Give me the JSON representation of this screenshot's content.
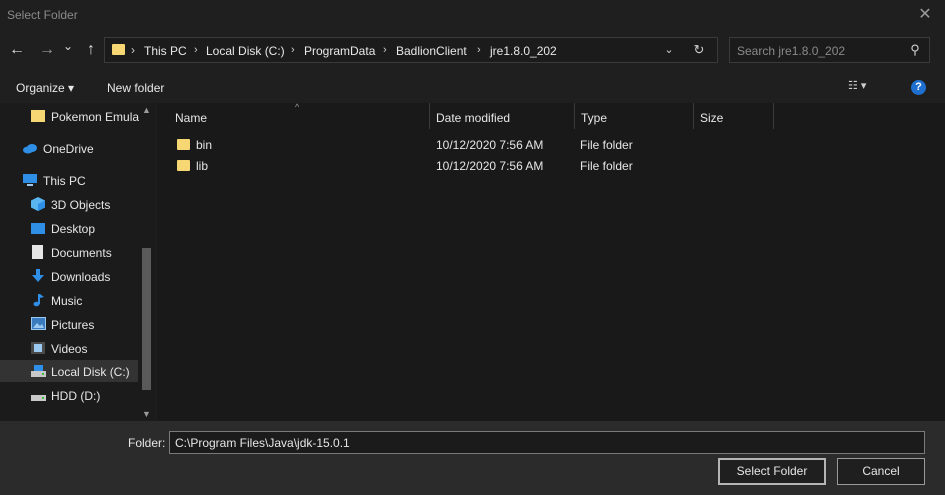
{
  "window": {
    "title": "Select Folder",
    "close_glyph": "✕"
  },
  "nav": {
    "back_glyph": "←",
    "forward_glyph": "→",
    "recent_glyph": "⌄",
    "up_glyph": "↑",
    "breadcrumb_sep": "›",
    "breadcrumbs": [
      "This PC",
      "Local Disk (C:)",
      "ProgramData",
      "BadlionClient",
      "jre1.8.0_202"
    ],
    "dropdown_glyph": "⌄",
    "refresh_glyph": "↻"
  },
  "search": {
    "placeholder": "Search jre1.8.0_202",
    "icon_glyph": "⚲"
  },
  "toolbar": {
    "organize_label": "Organize ▾",
    "new_folder_label": "New folder",
    "view_glyph": "☷ ▾",
    "help_glyph": "?"
  },
  "sidebar": {
    "items": [
      {
        "label": "Pokemon Emula",
        "icon": "folder-icon"
      },
      {
        "label": "OneDrive",
        "icon": "cloud-icon"
      },
      {
        "label": "This PC",
        "icon": "computer-icon"
      },
      {
        "label": "3D Objects",
        "icon": "cube-icon"
      },
      {
        "label": "Desktop",
        "icon": "desktop-icon"
      },
      {
        "label": "Documents",
        "icon": "document-icon"
      },
      {
        "label": "Downloads",
        "icon": "download-icon"
      },
      {
        "label": "Music",
        "icon": "music-icon"
      },
      {
        "label": "Pictures",
        "icon": "pictures-icon"
      },
      {
        "label": "Videos",
        "icon": "video-icon"
      },
      {
        "label": "Local Disk (C:)",
        "icon": "drive-icon"
      },
      {
        "label": "HDD (D:)",
        "icon": "drive-icon"
      }
    ],
    "selected": "Local Disk (C:)"
  },
  "columns": {
    "name": "Name",
    "date_modified": "Date modified",
    "type": "Type",
    "size": "Size",
    "sort_glyph": "^"
  },
  "files": [
    {
      "name": "bin",
      "date_modified": "10/12/2020 7:56 AM",
      "type": "File folder"
    },
    {
      "name": "lib",
      "date_modified": "10/12/2020 7:56 AM",
      "type": "File folder"
    }
  ],
  "footer": {
    "folder_label": "Folder:",
    "folder_value": "C:\\Program Files\\Java\\jdk-15.0.1",
    "select_button": "Select Folder",
    "cancel_button": "Cancel"
  },
  "colors": {
    "background": "#1e1e1e",
    "folder_yellow": "#f7d774",
    "help_blue": "#1e6fd0",
    "selected_row": "#333333"
  }
}
